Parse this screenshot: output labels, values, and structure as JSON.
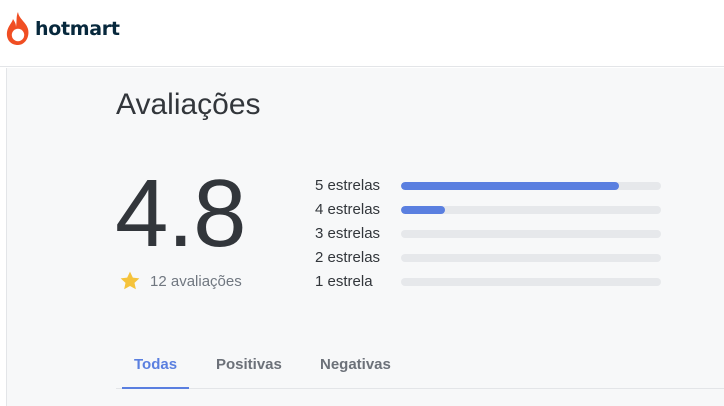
{
  "brand": {
    "name": "hotmart",
    "accent_color": "#f04e23",
    "text_color": "#07283c",
    "logo_icon": "flame-icon"
  },
  "reviews": {
    "title": "Avaliações",
    "average": "4.8",
    "count_label": "12 avaliações",
    "star_icon": "star-icon",
    "star_color": "#f5c33b",
    "bar_color": "#5a7fe0",
    "distribution": [
      {
        "label": "5 estrelas",
        "fraction": 0.84
      },
      {
        "label": "4 estrelas",
        "fraction": 0.17
      },
      {
        "label": "3 estrelas",
        "fraction": 0
      },
      {
        "label": "2 estrelas",
        "fraction": 0
      },
      {
        "label": "1 estrela",
        "fraction": 0
      }
    ]
  },
  "tabs": [
    {
      "label": "Todas",
      "active": true
    },
    {
      "label": "Positivas",
      "active": false
    },
    {
      "label": "Negativas",
      "active": false
    }
  ]
}
